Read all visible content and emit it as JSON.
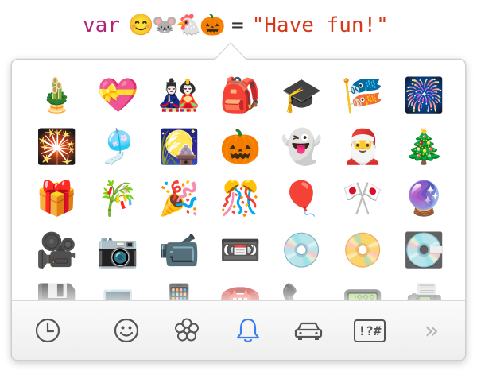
{
  "code": {
    "keyword": "var",
    "emojis": [
      "😊",
      "🐭",
      "🐔",
      "🎃"
    ],
    "operator": "=",
    "string": "\"Have fun!\""
  },
  "grid": {
    "rows": [
      [
        "🎍",
        "💝",
        "🎎",
        "🎒",
        "🎓",
        "🎏",
        "🎆"
      ],
      [
        "🎇",
        "🎐",
        "🎑",
        "🎃",
        "👻",
        "🎅",
        "🎄"
      ],
      [
        "🎁",
        "🎋",
        "🎉",
        "🎊",
        "🎈",
        "🎌",
        "🔮"
      ],
      [
        "🎥",
        "📷",
        "📹",
        "📼",
        "💿",
        "📀",
        "💽"
      ],
      [
        "💾",
        "💻",
        "📱",
        "☎️",
        "📞",
        "📟",
        "📠"
      ]
    ]
  },
  "toolbar": {
    "items": [
      {
        "name": "recent-clock-icon"
      },
      {
        "name": "people-smiley-icon"
      },
      {
        "name": "nature-flower-icon"
      },
      {
        "name": "objects-bell-icon",
        "selected": true
      },
      {
        "name": "places-car-icon"
      },
      {
        "name": "symbols-icon",
        "label": "!?#"
      },
      {
        "name": "more-icon",
        "label": "»"
      }
    ]
  },
  "colors": {
    "keyword": "#b3237a",
    "string": "#d63a1a",
    "selected_tab": "#3a7ff0",
    "tab_icon": "#555555"
  }
}
